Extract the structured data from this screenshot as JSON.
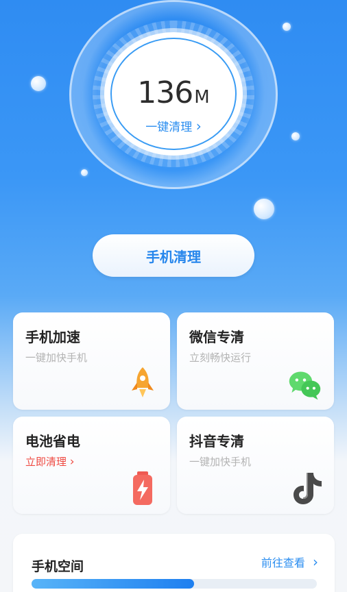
{
  "cleaner": {
    "size_value": "136",
    "size_unit": "M",
    "one_key_clean": "一键清理",
    "chevron": "›"
  },
  "main_button": {
    "label": "手机清理"
  },
  "cards": [
    {
      "title": "手机加速",
      "subtitle": "一键加快手机",
      "icon": "rocket-icon"
    },
    {
      "title": "微信专清",
      "subtitle": "立刻畅快运行",
      "icon": "wechat-icon"
    },
    {
      "title": "电池省电",
      "subtitle": "立即清理",
      "subtitle_suffix": "›",
      "icon": "battery-icon"
    },
    {
      "title": "抖音专清",
      "subtitle": "一键加快手机",
      "icon": "douyin-icon"
    }
  ],
  "storage": {
    "title": "手机空间",
    "link": "前往查看",
    "chevron": "›",
    "used_fraction": 0.57
  },
  "colors": {
    "accent": "#2b8ef0",
    "warning": "#ef4a42",
    "rocket": "#f6a531",
    "wechat": "#4cd45d",
    "battery": "#ef5a52"
  }
}
